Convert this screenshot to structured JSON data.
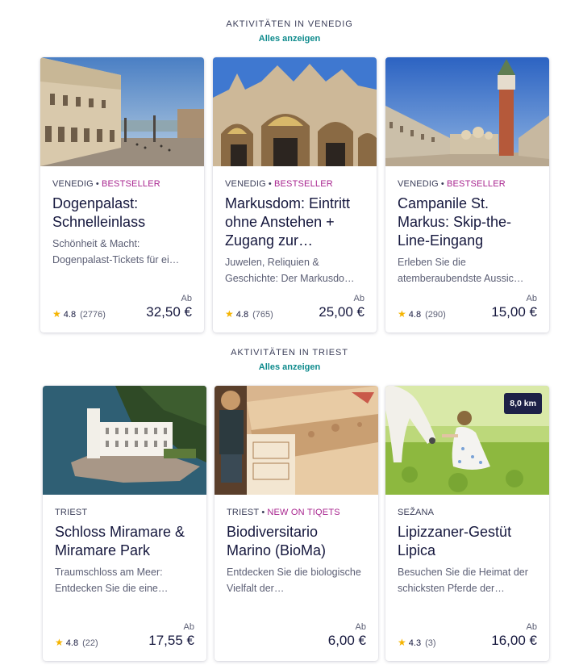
{
  "sections": [
    {
      "title": "AKTIVITÄTEN IN VENEDIG",
      "link": "Alles anzeigen",
      "cards": [
        {
          "location": "VENEDIG",
          "tag": "BESTSELLER",
          "title": "Dogenpalast: Schnelleinlass",
          "description": "Schönheit & Macht: Dogenpalast-Tickets für ei…",
          "rating": "4.8",
          "reviews": "(2776)",
          "from_label": "Ab",
          "price": "32,50 €",
          "image": "doges-palace-photo"
        },
        {
          "location": "VENEDIG",
          "tag": "BESTSELLER",
          "title": "Markusdom: Eintritt ohne Anstehen + Zugang zur…",
          "description": "Juwelen, Reliquien & Geschichte: Der Markusdo…",
          "rating": "4.8",
          "reviews": "(765)",
          "from_label": "Ab",
          "price": "25,00 €",
          "image": "st-marks-basilica-photo"
        },
        {
          "location": "VENEDIG",
          "tag": "BESTSELLER",
          "title": "Campanile St. Markus: Skip-the-Line-Eingang",
          "description": "Erleben Sie die atemberaubendste Aussic…",
          "rating": "4.8",
          "reviews": "(290)",
          "from_label": "Ab",
          "price": "15,00 €",
          "image": "campanile-photo"
        }
      ]
    },
    {
      "title": "AKTIVITÄTEN IN TRIEST",
      "link": "Alles anzeigen",
      "cards": [
        {
          "location": "TRIEST",
          "tag": "",
          "title": "Schloss Miramare & Miramare Park",
          "description": "Traumschloss am Meer: Entdecken Sie die eine…",
          "rating": "4.8",
          "reviews": "(22)",
          "from_label": "Ab",
          "price": "17,55 €",
          "image": "miramare-castle-photo"
        },
        {
          "location": "TRIEST",
          "tag": "NEW ON TIQETS",
          "title": "Biodiversitario Marino (BioMa)",
          "description": "Entdecken Sie die biologische Vielfalt der…",
          "rating": "",
          "reviews": "",
          "from_label": "Ab",
          "price": "6,00 €",
          "image": "bioma-museum-photo"
        },
        {
          "location": "SEŽANA",
          "tag": "",
          "title": "Lipizzaner-Gestüt Lipica",
          "description": "Besuchen Sie die Heimat der schicksten Pferde der…",
          "rating": "4.3",
          "reviews": "(3)",
          "from_label": "Ab",
          "price": "16,00 €",
          "image": "lipica-horse-photo",
          "distance_badge": "8,0 km"
        }
      ]
    }
  ],
  "colors": {
    "accent_link": "#0f8b8d",
    "tag": "#a8258f",
    "star": "#f5b400",
    "text": "#15173d"
  }
}
